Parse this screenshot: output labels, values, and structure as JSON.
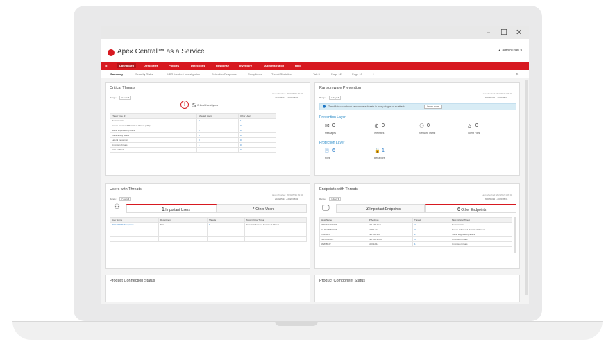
{
  "window": {
    "minimize": "–",
    "maximize": "☐",
    "close": "✕"
  },
  "app": {
    "title": "Apex Central™ as a Service",
    "user": "▲ admin.user ▾"
  },
  "nav": {
    "items": [
      "Dashboard",
      "Directories",
      "Policies",
      "Detections",
      "Response",
      "Inventory",
      "Administration",
      "Help"
    ]
  },
  "tabs": {
    "items": [
      "Summary",
      "Security Risks",
      "XDR Incident Investigation",
      "Detection Response",
      "Compliance",
      "Threat Statistics",
      "Tab 3",
      "Page 12",
      "Page 13",
      "+"
    ],
    "settings": "⚙"
  },
  "critical": {
    "title": "Critical Threats",
    "range_label": "Range:",
    "range_value": "7 days ▾",
    "last_updated": "Last refreshed: 2020/05/31 09:02",
    "date_range": "2020/05/24 ~ 2020/05/31",
    "count": "5",
    "count_label": "Critical threat types",
    "headers": [
      "Threat Type (1)",
      "Affected Users",
      "Other Users"
    ],
    "rows": [
      [
        "Ransomware",
        "3",
        "1"
      ],
      [
        "Known Advanced Persistent Threat (APT)",
        "1",
        "0"
      ],
      [
        "Social engineering attack",
        "0",
        "0"
      ],
      [
        "Vulnerability attack",
        "0",
        "0"
      ],
      [
        "Lateral movement",
        "0",
        "0"
      ],
      [
        "Unknown threats",
        "1",
        "0"
      ],
      [
        "C&C callback",
        "1",
        "0"
      ]
    ]
  },
  "response": {
    "title": "Ransomware Prevention",
    "range_label": "Range:",
    "range_value": "7 days ▾",
    "last_updated": "Last refreshed: 2020/05/31 09:02",
    "date_range": "2020/05/24 ~ 2020/05/31",
    "info": "Trend Micro can block ransomware threats in many stages of an attack.",
    "info_button": "Learn more",
    "prevention_title": "Prevention Layer",
    "prevention": [
      {
        "icon": "✉",
        "value": "0",
        "label": "Messages"
      },
      {
        "icon": "⊕",
        "value": "0",
        "label": "Websites"
      },
      {
        "icon": "⚇",
        "value": "0",
        "label": "Network Traffic"
      },
      {
        "icon": "⌂",
        "value": "0",
        "label": "Client Files"
      }
    ],
    "protection_title": "Protection Layer",
    "protection": [
      {
        "icon": "🗎",
        "value": "6",
        "label": "Files"
      },
      {
        "icon": "🔒",
        "value": "1",
        "label": "Behaviors"
      }
    ]
  },
  "users": {
    "title": "Users with Threats",
    "range_label": "Range:",
    "range_value": "7 days ▾",
    "last_updated": "Last refreshed: 2020/05/31 09:02",
    "date_range": "2020/05/24 ~ 2020/05/31",
    "box1": {
      "count": "1",
      "label": "Important Users"
    },
    "box2": {
      "count": "7",
      "label": "Other Users"
    },
    "headers": [
      "User Name",
      "Department",
      "Threats",
      "Most Critical Threat"
    ],
    "rows": [
      [
        "PHILLIPS\\Dehon.james",
        "N/A",
        "1",
        "Known Advanced Persistent Threat"
      ]
    ]
  },
  "endpoints": {
    "title": "Endpoints with Threats",
    "range_label": "Range:",
    "range_value": "7 days ▾",
    "last_updated": "Last refreshed: 2020/05/31 09:02",
    "date_range": "2020/05/24 ~ 2020/05/31",
    "box1": {
      "count": "2",
      "label": "Important Endpoints"
    },
    "box2": {
      "count": "6",
      "label": "Other Endpoints"
    },
    "headers": [
      "Host Name",
      "IP Address",
      "Threats",
      "Most Critical Threat"
    ],
    "rows": [
      [
        "WIN7NETWORK",
        "192.168.2.10",
        "2",
        "Ransomware"
      ],
      [
        "CLIE-WINDOWS",
        "10.8.2.24",
        "3",
        "Known Advanced Persistent Threat"
      ],
      [
        "VMCM-5",
        "192.168.1.6",
        "1",
        "Social engineering attack"
      ],
      [
        "SRV-OM-667",
        "192.168.1.110",
        "5",
        "Unknown threats"
      ],
      [
        "W2K8R2T",
        "10.0.12.14",
        "1",
        "Unknown threats"
      ]
    ]
  },
  "product_connection": {
    "title": "Product Connection Status"
  },
  "product_component": {
    "title": "Product Component Status"
  }
}
